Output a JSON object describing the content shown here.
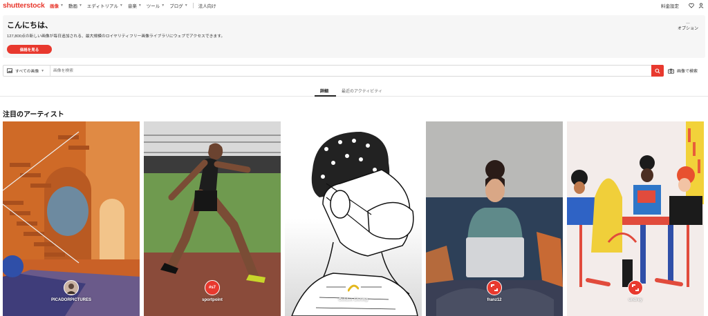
{
  "header": {
    "logo": "shutterstock",
    "nav": [
      {
        "label": "画像",
        "active": true,
        "has_menu": true
      },
      {
        "label": "動画",
        "active": false,
        "has_menu": true
      },
      {
        "label": "エディトリアル",
        "active": false,
        "has_menu": true
      },
      {
        "label": "音楽",
        "active": false,
        "has_menu": true
      },
      {
        "label": "ツール",
        "active": false,
        "has_menu": true
      },
      {
        "label": "ブログ",
        "active": false,
        "has_menu": true
      }
    ],
    "enterprise": "法人向け",
    "pricing": "料金設定",
    "icons": [
      "heart-icon",
      "user-icon"
    ]
  },
  "banner": {
    "greeting": "こんにちは、",
    "subtitle": "127,800点の新しい画像が毎日追加される、最大規模のロイヤリティフリー画像ライブラリにウェブでアクセスできます。",
    "cta": "価格を見る",
    "options_dots": "…",
    "options_label": "オプション"
  },
  "search": {
    "type_label": "すべての画像",
    "placeholder": "画像を検索",
    "image_search_label": "画像で検索"
  },
  "tabs": [
    {
      "label": "詳細",
      "active": true
    },
    {
      "label": "最近のアクティビティ",
      "active": false
    }
  ],
  "featured": {
    "title": "注目のアーティスト",
    "artists": [
      {
        "name": "PICADORPICTURES",
        "avatar_icon": "portrait-avatar"
      },
      {
        "name": "sportpoint",
        "avatar_text": "#s7",
        "avatar_color": "#e8392e"
      },
      {
        "name": "Golden Shrimp",
        "avatar_icon": "shrimp-logo"
      },
      {
        "name": "franz12",
        "avatar_icon": "shutterstock-logo",
        "avatar_color": "#e8392e"
      },
      {
        "name": "undrey",
        "avatar_icon": "shutterstock-logo",
        "avatar_color": "#e8392e"
      }
    ]
  },
  "colors": {
    "brand": "#e8392e"
  }
}
